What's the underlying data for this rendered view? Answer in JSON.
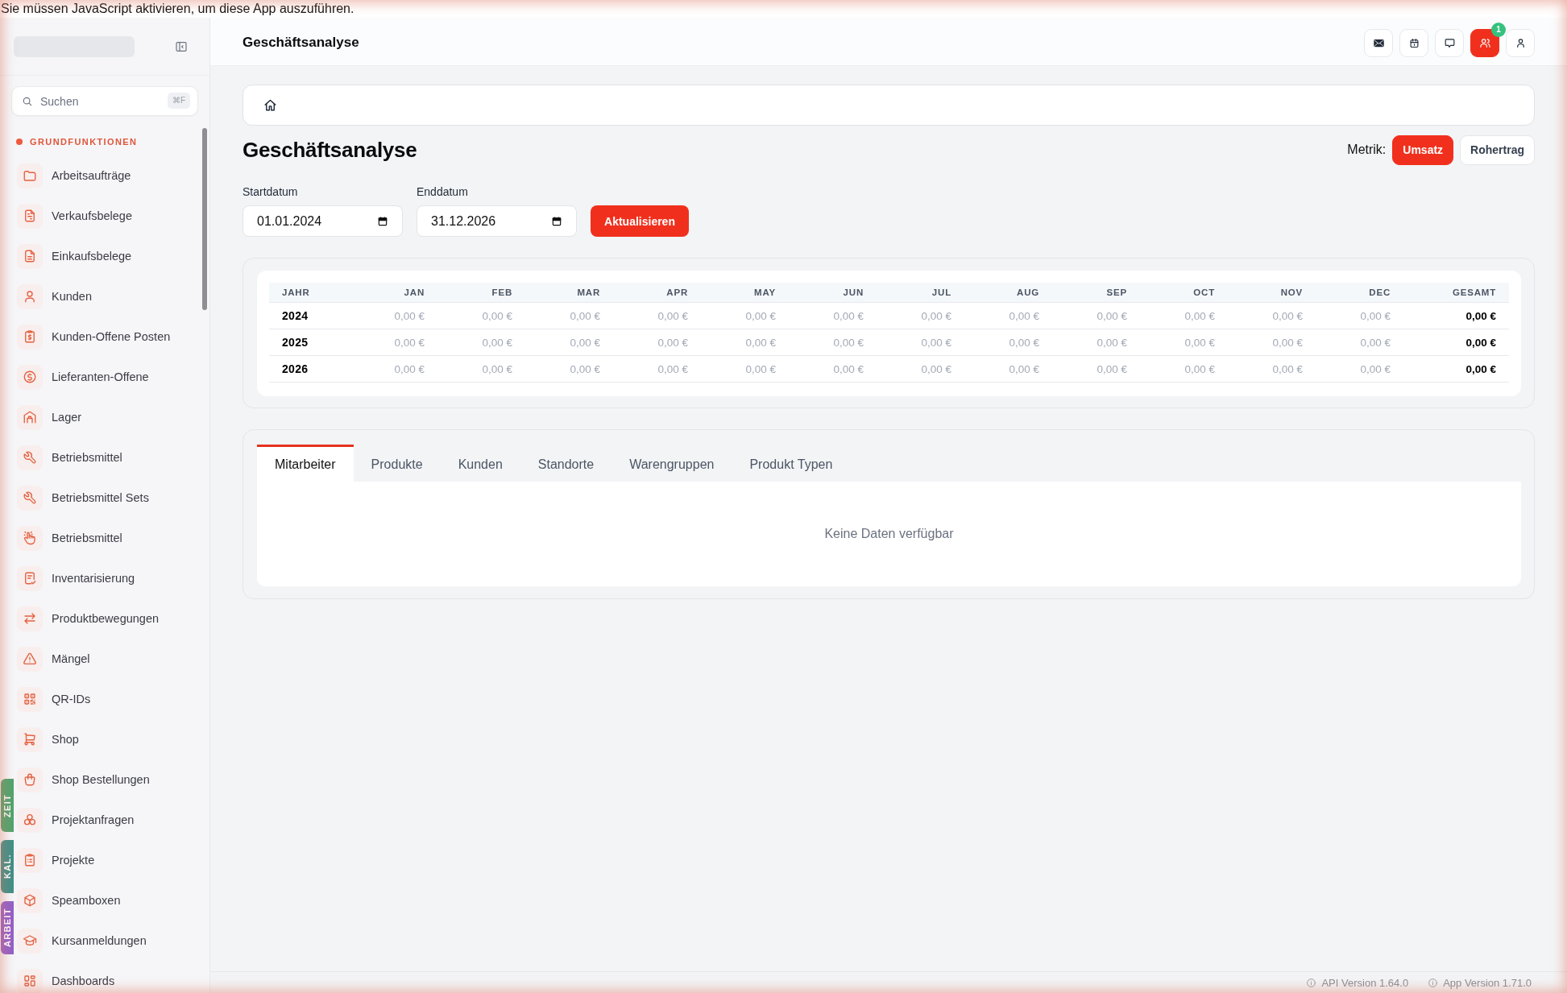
{
  "notice": "Sie müssen JavaScript aktivieren, um diese App auszuführen.",
  "sidebar": {
    "search": {
      "placeholder": "Suchen",
      "shortcut": "⌘F"
    },
    "section": "GRUNDFUNKTIONEN",
    "items": [
      {
        "label": "Arbeitsaufträge"
      },
      {
        "label": "Verkaufsbelege"
      },
      {
        "label": "Einkaufsbelege"
      },
      {
        "label": "Kunden"
      },
      {
        "label": "Kunden-Offene Posten"
      },
      {
        "label": "Lieferanten-Offene"
      },
      {
        "label": "Lager"
      },
      {
        "label": "Betriebsmittel"
      },
      {
        "label": "Betriebsmittel Sets"
      },
      {
        "label": "Betriebsmittel"
      },
      {
        "label": "Inventarisierung"
      },
      {
        "label": "Produktbewegungen"
      },
      {
        "label": "Mängel"
      },
      {
        "label": "QR-IDs"
      },
      {
        "label": "Shop"
      },
      {
        "label": "Shop Bestellungen"
      },
      {
        "label": "Projektanfragen"
      },
      {
        "label": "Projekte"
      },
      {
        "label": "Speamboxen"
      },
      {
        "label": "Kursanmeldungen"
      },
      {
        "label": "Dashboards"
      }
    ],
    "side_tabs": [
      {
        "label": "ZEIT",
        "color": "#4fa46e"
      },
      {
        "label": "KAL.",
        "color": "#3f9088"
      },
      {
        "label": "ARBEIT",
        "color": "#9360c9"
      }
    ]
  },
  "topbar": {
    "title": "Geschäftsanalyse",
    "buttons": [
      {
        "active": false
      },
      {
        "active": false
      },
      {
        "active": false
      },
      {
        "active": true,
        "badge": "1"
      },
      {
        "active": false
      }
    ]
  },
  "page": {
    "title": "Geschäftsanalyse",
    "metric": {
      "label": "Metrik:",
      "options": [
        {
          "label": "Umsatz",
          "selected": true
        },
        {
          "label": "Rohertrag",
          "selected": false
        }
      ]
    }
  },
  "filters": {
    "fields": [
      {
        "label": "Startdatum",
        "value": "01.01.2024"
      },
      {
        "label": "Enddatum",
        "value": "31.12.2026"
      }
    ],
    "button": "Aktualisieren"
  },
  "table": {
    "columns": [
      "JAHR",
      "JAN",
      "FEB",
      "MAR",
      "APR",
      "MAY",
      "JUN",
      "JUL",
      "AUG",
      "SEP",
      "OCT",
      "NOV",
      "DEC",
      "GESAMT"
    ],
    "rows": [
      [
        "2024",
        "0,00 €",
        "0,00 €",
        "0,00 €",
        "0,00 €",
        "0,00 €",
        "0,00 €",
        "0,00 €",
        "0,00 €",
        "0,00 €",
        "0,00 €",
        "0,00 €",
        "0,00 €",
        "0,00 €"
      ],
      [
        "2025",
        "0,00 €",
        "0,00 €",
        "0,00 €",
        "0,00 €",
        "0,00 €",
        "0,00 €",
        "0,00 €",
        "0,00 €",
        "0,00 €",
        "0,00 €",
        "0,00 €",
        "0,00 €",
        "0,00 €"
      ],
      [
        "2026",
        "0,00 €",
        "0,00 €",
        "0,00 €",
        "0,00 €",
        "0,00 €",
        "0,00 €",
        "0,00 €",
        "0,00 €",
        "0,00 €",
        "0,00 €",
        "0,00 €",
        "0,00 €",
        "0,00 €"
      ]
    ]
  },
  "breakdown": {
    "tabs": [
      {
        "label": "Mitarbeiter",
        "selected": true
      },
      {
        "label": "Produkte",
        "selected": false
      },
      {
        "label": "Kunden",
        "selected": false
      },
      {
        "label": "Standorte",
        "selected": false
      },
      {
        "label": "Warengruppen",
        "selected": false
      },
      {
        "label": "Produkt Typen",
        "selected": false
      }
    ],
    "empty_text": "Keine Daten verfügbar"
  },
  "footer": {
    "versions": [
      "API Version 1.64.0",
      "App Version 1.71.0"
    ]
  }
}
